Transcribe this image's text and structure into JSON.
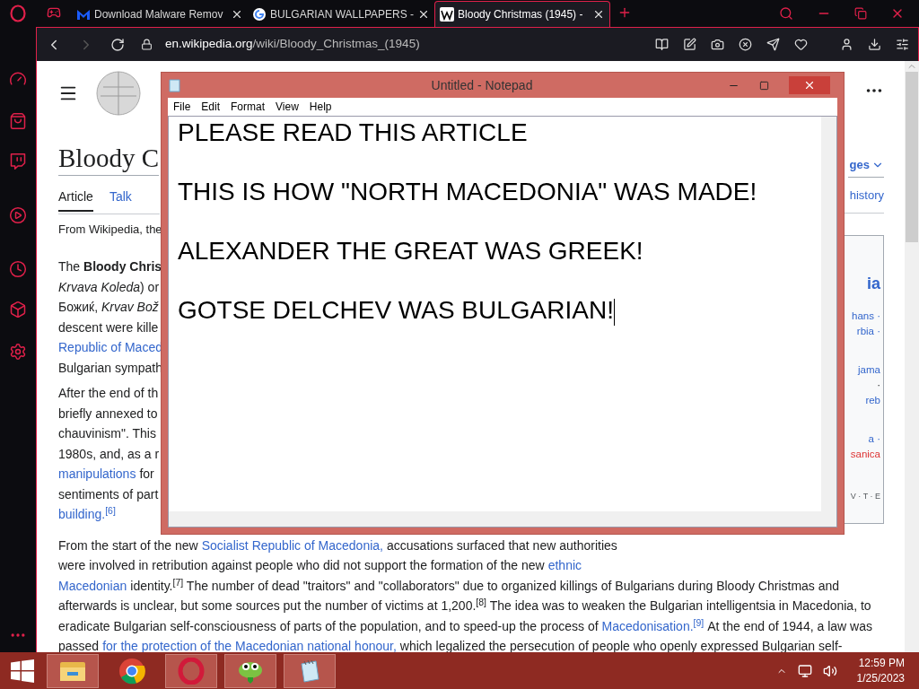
{
  "browser": {
    "tabs": [
      {
        "kind": "malware",
        "title": "Download Malware Remov",
        "selected": false
      },
      {
        "kind": "google",
        "title": "BULGARIAN WALLPAPERS -",
        "selected": false
      },
      {
        "kind": "wikipedia",
        "title": "Bloody Christmas (1945) -",
        "selected": true
      }
    ],
    "nav": {
      "back_disabled": false,
      "forward_disabled": true
    },
    "address": {
      "domain": "en.wikipedia.org",
      "path": "/wiki/Bloody_Christmas_(1945)"
    }
  },
  "wiki": {
    "title": "Bloody C",
    "tabs": [
      {
        "label": "Article",
        "selected": true
      },
      {
        "label": "Talk",
        "selected": false
      }
    ],
    "right_tabs": {
      "languages": "ges",
      "history": "history"
    },
    "left_lines": [
      [
        {
          "kind": "text",
          "text": "From Wikipedia, the"
        }
      ],
      [
        {
          "kind": "gap"
        }
      ],
      [
        {
          "kind": "text",
          "text": "The **Bloody Chris**"
        }
      ],
      [
        {
          "kind": "text",
          "text": "*Krvava Koleda*) or"
        }
      ],
      [
        {
          "kind": "text",
          "text": "Божиќ, *Krvav Bož*"
        }
      ],
      [
        {
          "kind": "text",
          "text": "descent were kille"
        }
      ],
      [
        {
          "kind": "link",
          "text": "Republic of Maced"
        }
      ],
      [
        {
          "kind": "text",
          "text": "Bulgarian sympath"
        }
      ],
      [
        {
          "kind": "gap"
        }
      ],
      [
        {
          "kind": "text",
          "text": "After the end of th"
        }
      ],
      [
        {
          "kind": "text",
          "text": "briefly annexed to"
        }
      ],
      [
        {
          "kind": "text",
          "text": "chauvinism\". This"
        }
      ],
      [
        {
          "kind": "text",
          "text": "1980s, and, as a r"
        }
      ],
      [
        {
          "kind": "link",
          "text": "manipulations"
        },
        {
          "kind": "text",
          "text": "for"
        }
      ],
      [
        {
          "kind": "text",
          "text": "sentiments of part"
        }
      ],
      [
        {
          "kind": "link",
          "text": "building.$^{[6]}$"
        }
      ]
    ],
    "infobox": [
      {
        "kind": "title",
        "text": "ia"
      },
      {
        "kind": "link",
        "text": "hans ·"
      },
      {
        "kind": "link",
        "text": "rbia ·"
      },
      {
        "kind": "gap"
      },
      {
        "kind": "link",
        "text": "jama"
      },
      {
        "kind": "text",
        "text": "·"
      },
      {
        "kind": "link",
        "text": "reb"
      },
      {
        "kind": "gap"
      },
      {
        "kind": "link",
        "text": "a ·"
      },
      {
        "kind": "redlink",
        "text": "sanica"
      },
      {
        "kind": "gap"
      },
      {
        "kind": "nav",
        "text": "V · T · E"
      }
    ],
    "body_lines": [
      [
        {
          "kind": "text",
          "text": "From the start of the new"
        },
        {
          "kind": "link",
          "text": "Socialist Republic of Macedonia,"
        },
        {
          "kind": "text",
          "text": "accusations surfaced that new authorities"
        }
      ],
      [
        {
          "kind": "text",
          "text": "were involved in retribution against people who did not support the formation of the new"
        },
        {
          "kind": "link",
          "text": "ethnic"
        }
      ],
      [
        {
          "kind": "link",
          "text": "Macedonian"
        },
        {
          "kind": "text",
          "text": "identity.$^{[7]}$ The number of dead \"traitors\" and \"collaborators\" due to organized killings of Bulgarians during Bloody Christmas and"
        }
      ],
      [
        {
          "kind": "text",
          "text": "afterwards is unclear, but some sources put the number of victims at 1,200.$^{[8]}$ The idea was to weaken the Bulgarian intelligentsia in Macedonia, to"
        }
      ],
      [
        {
          "kind": "text",
          "text": "eradicate Bulgarian self-consciousness of parts of the population, and to speed-up the process of"
        },
        {
          "kind": "link",
          "text": "Macedonisation.$^{[9]}$"
        },
        {
          "kind": "text",
          "text": "At the end of 1944, a law was"
        }
      ],
      [
        {
          "kind": "text",
          "text": "passed"
        },
        {
          "kind": "link",
          "text": "for the protection of the Macedonian national honour,"
        },
        {
          "kind": "text",
          "text": "which legalized the persecution of people who openly expressed Bulgarian self-"
        }
      ]
    ]
  },
  "notepad": {
    "title": "Untitled - Notepad",
    "menu": [
      "File",
      "Edit",
      "Format",
      "View",
      "Help"
    ],
    "content": "PLEASE READ THIS ARTICLE\n\nTHIS IS HOW \"NORTH MACEDONIA\" WAS MADE!\n\nALEXANDER THE GREAT WAS GREEK!\n\nGOTSE DELCHEV WAS BULGARIAN!"
  },
  "taskbar": {
    "apps": [
      {
        "kind": "explorer",
        "active": true
      },
      {
        "kind": "chrome",
        "active": false
      },
      {
        "kind": "opera",
        "active": true
      },
      {
        "kind": "chameleon",
        "active": true
      },
      {
        "kind": "notepad",
        "active": true
      }
    ],
    "time": "12:59 PM",
    "date": "1/25/2023"
  }
}
